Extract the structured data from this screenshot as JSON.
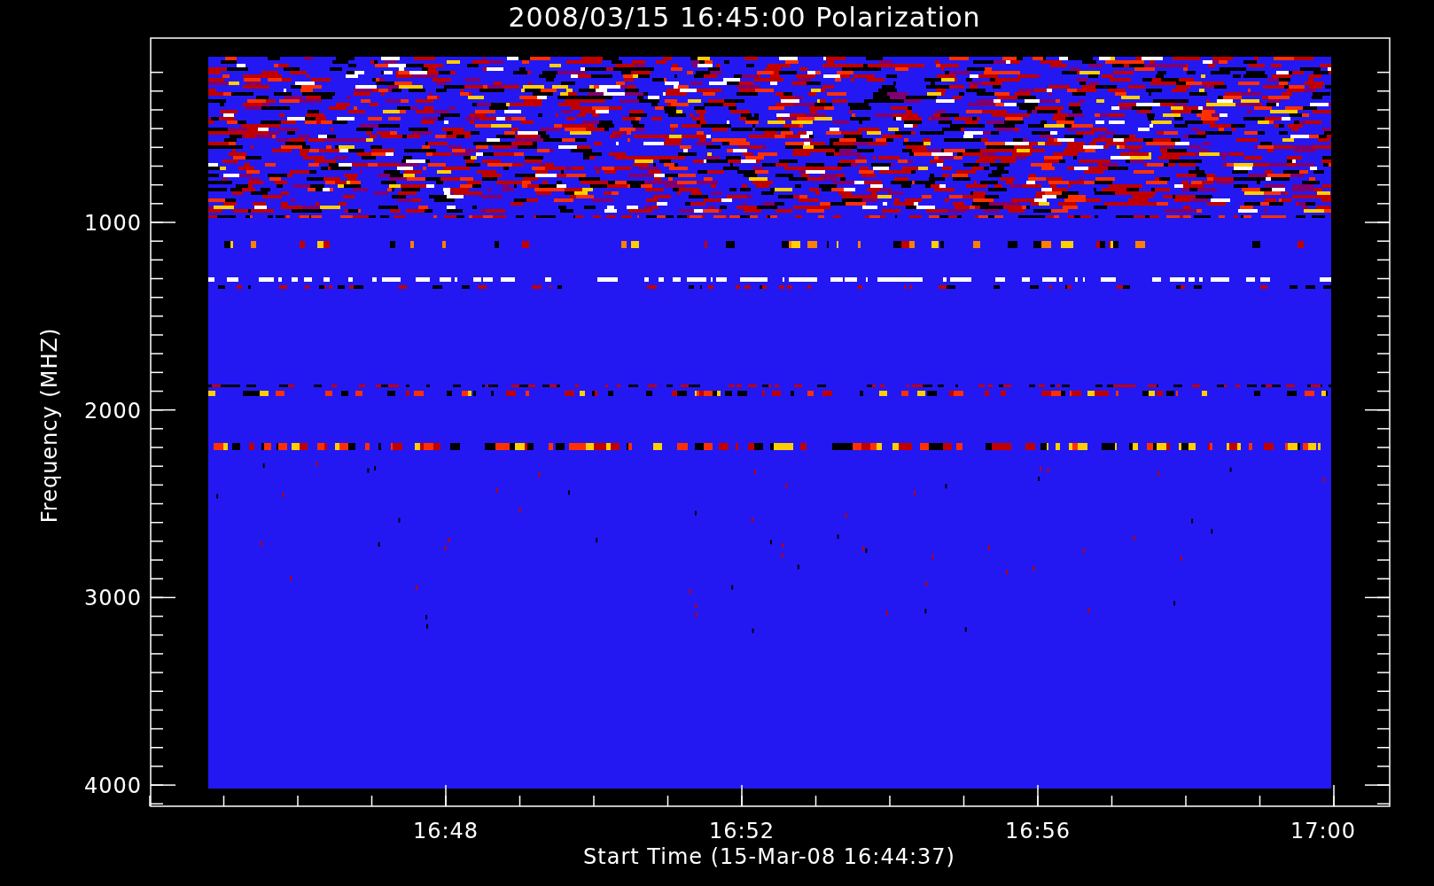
{
  "title": "2008/03/15 16:45:00 Polarization",
  "y_axis": {
    "label": "Frequency (MHZ)",
    "ticks": [
      "1000",
      "2000",
      "3000",
      "4000"
    ]
  },
  "x_axis": {
    "label": "Start Time (15-Mar-08 16:44:37)",
    "ticks": [
      "16:48",
      "16:52",
      "16:56",
      "17:00"
    ]
  },
  "spectrogram": {
    "kind": "spectrogram"
  }
}
